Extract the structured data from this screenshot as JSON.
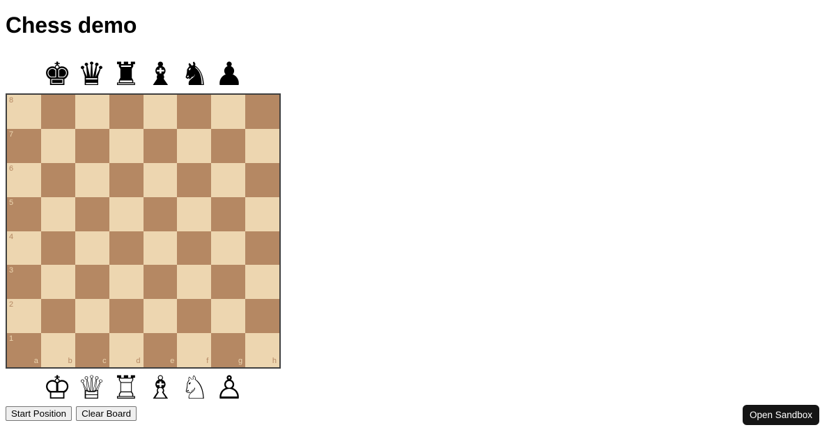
{
  "page": {
    "title": "Chess demo"
  },
  "board": {
    "light_square_color": "#EDD6B0",
    "dark_square_color": "#B58863",
    "border_color": "#404040",
    "ranks": [
      "8",
      "7",
      "6",
      "5",
      "4",
      "3",
      "2",
      "1"
    ],
    "files": [
      "a",
      "b",
      "c",
      "d",
      "e",
      "f",
      "g",
      "h"
    ],
    "position": "empty"
  },
  "spares": {
    "black": [
      {
        "name": "black-king",
        "glyph": "♚"
      },
      {
        "name": "black-queen",
        "glyph": "♛"
      },
      {
        "name": "black-rook",
        "glyph": "♜"
      },
      {
        "name": "black-bishop",
        "glyph": "♝"
      },
      {
        "name": "black-knight",
        "glyph": "♞"
      },
      {
        "name": "black-pawn",
        "glyph": "♟"
      }
    ],
    "white": [
      {
        "name": "white-king",
        "glyph": "♔"
      },
      {
        "name": "white-queen",
        "glyph": "♕"
      },
      {
        "name": "white-rook",
        "glyph": "♖"
      },
      {
        "name": "white-bishop",
        "glyph": "♗"
      },
      {
        "name": "white-knight",
        "glyph": "♘"
      },
      {
        "name": "white-pawn",
        "glyph": "♙"
      }
    ]
  },
  "controls": {
    "start_position_label": "Start Position",
    "clear_board_label": "Clear Board"
  },
  "sandbox": {
    "label": "Open Sandbox",
    "background_color": "#151515",
    "text_color": "#ffffff"
  }
}
